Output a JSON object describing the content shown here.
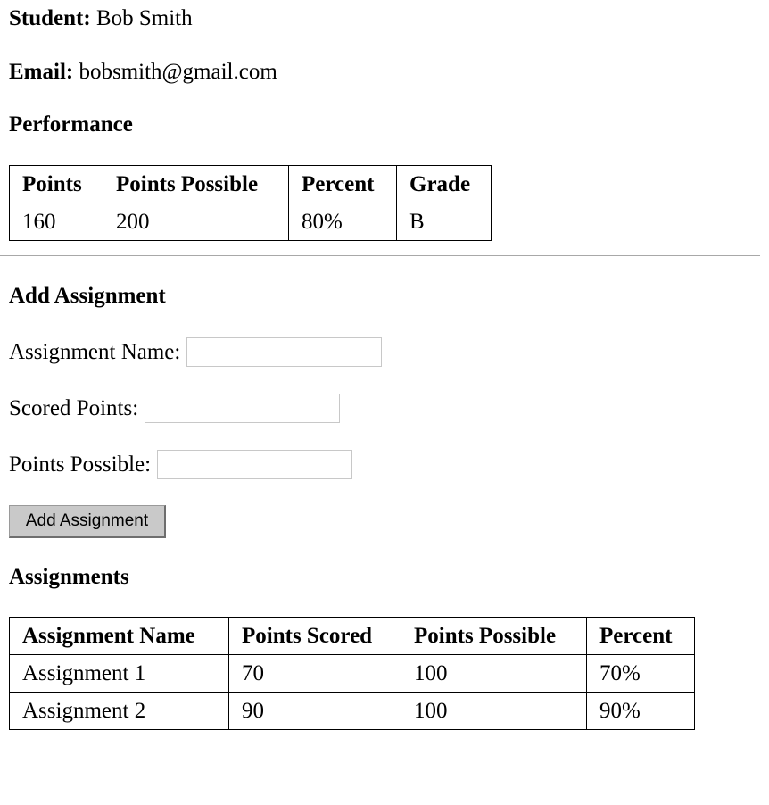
{
  "student": {
    "label": "Student:",
    "name": "Bob Smith"
  },
  "email": {
    "label": "Email:",
    "value": "bobsmith@gmail.com"
  },
  "performance": {
    "heading": "Performance",
    "headers": [
      "Points",
      "Points Possible",
      "Percent",
      "Grade"
    ],
    "row": [
      "160",
      "200",
      "80%",
      "B"
    ]
  },
  "add_assignment": {
    "heading": "Add Assignment",
    "name_label": "Assignment Name:",
    "name_value": "",
    "scored_label": "Scored Points:",
    "scored_value": "",
    "possible_label": "Points Possible:",
    "possible_value": "",
    "button_label": "Add Assignment"
  },
  "assignments": {
    "heading": "Assignments",
    "headers": [
      "Assignment Name",
      "Points Scored",
      "Points Possible",
      "Percent"
    ],
    "rows": [
      [
        "Assignment 1",
        "70",
        "100",
        "70%"
      ],
      [
        "Assignment 2",
        "90",
        "100",
        "90%"
      ]
    ]
  }
}
